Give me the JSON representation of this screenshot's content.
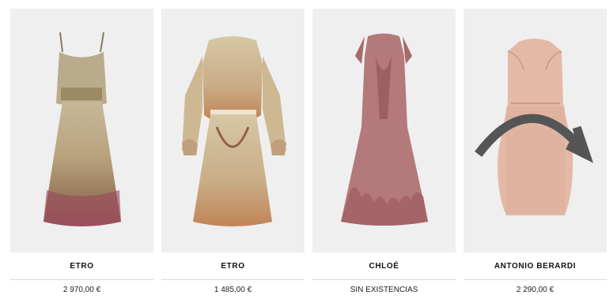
{
  "products": [
    {
      "brand": "ETRO",
      "price": "2 970,00 €",
      "image": "dress-icon"
    },
    {
      "brand": "ETRO",
      "price": "1 485,00 €",
      "image": "dress-icon"
    },
    {
      "brand": "CHLOÉ",
      "price": "SIN EXISTENCIAS",
      "image": "dress-icon"
    },
    {
      "brand": "ANTONIO BERARDI",
      "price": "2 290,00 €",
      "image": "dress-icon"
    }
  ]
}
